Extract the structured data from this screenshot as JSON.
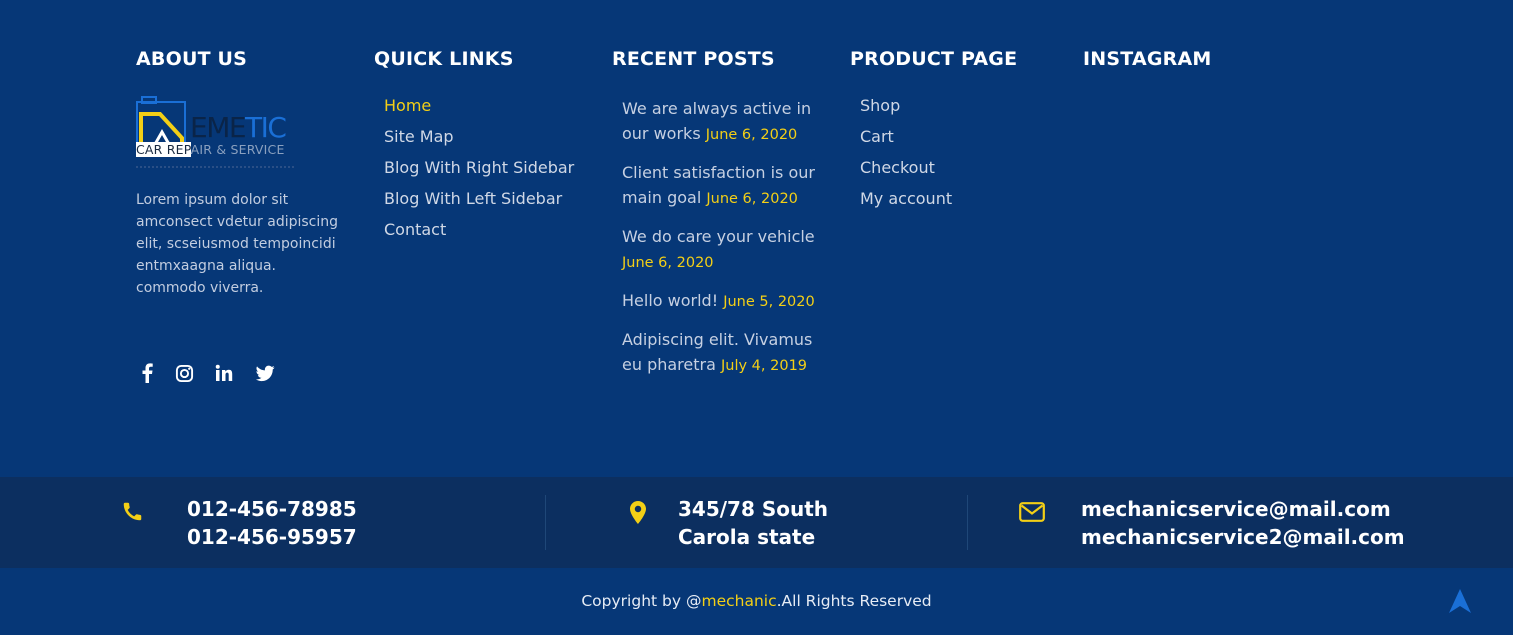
{
  "about": {
    "heading": "ABOUT US",
    "logo_word_dark": "EME",
    "logo_word_light": "TIC",
    "logo_sub_a": "CAR REP",
    "logo_sub_b": "AIR & SERVICE",
    "text": "Lorem ipsum dolor sit amconsect vdetur adipiscing elit, scseiusmod tempoincidi entmxaagna aliqua. commodo viverra."
  },
  "quick_links": {
    "heading": "QUICK LINKS",
    "items": [
      {
        "label": "Home"
      },
      {
        "label": "Site Map"
      },
      {
        "label": "Blog With Right Sidebar"
      },
      {
        "label": "Blog With Left Sidebar"
      },
      {
        "label": "Contact"
      }
    ]
  },
  "recent_posts": {
    "heading": "RECENT POSTS",
    "items": [
      {
        "title": "We are always active in our works",
        "date": "June 6, 2020"
      },
      {
        "title": "Client satisfaction is our main goal",
        "date": "June 6, 2020"
      },
      {
        "title": "We do care your vehicle",
        "date": "June 6, 2020"
      },
      {
        "title": "Hello world!",
        "date": "June 5, 2020"
      },
      {
        "title": "Adipiscing elit. Vivamus eu pharetra",
        "date": "July 4, 2019"
      }
    ]
  },
  "product_page": {
    "heading": "PRODUCT PAGE",
    "items": [
      {
        "label": "Shop"
      },
      {
        "label": "Cart"
      },
      {
        "label": "Checkout"
      },
      {
        "label": "My account"
      }
    ]
  },
  "instagram": {
    "heading": "INSTAGRAM"
  },
  "contact": {
    "phone1": "012-456-78985",
    "phone2": "012-456-95957",
    "address1": "345/78 South",
    "address2": "Carola state",
    "email1": "mechanicservice@mail.com",
    "email2": "mechanicservice2@mail.com"
  },
  "copyright": {
    "prefix": "Copyright by @",
    "link": "mechanic",
    "suffix": ".All Rights Reserved"
  },
  "colors": {
    "background": "#063777",
    "contact_bar": "#0c2f60",
    "accent": "#f3cf16"
  },
  "icons": [
    "facebook-icon",
    "instagram-icon",
    "linkedin-icon",
    "twitter-icon",
    "phone-icon",
    "map-pin-icon",
    "envelope-icon",
    "arrow-up-icon"
  ]
}
